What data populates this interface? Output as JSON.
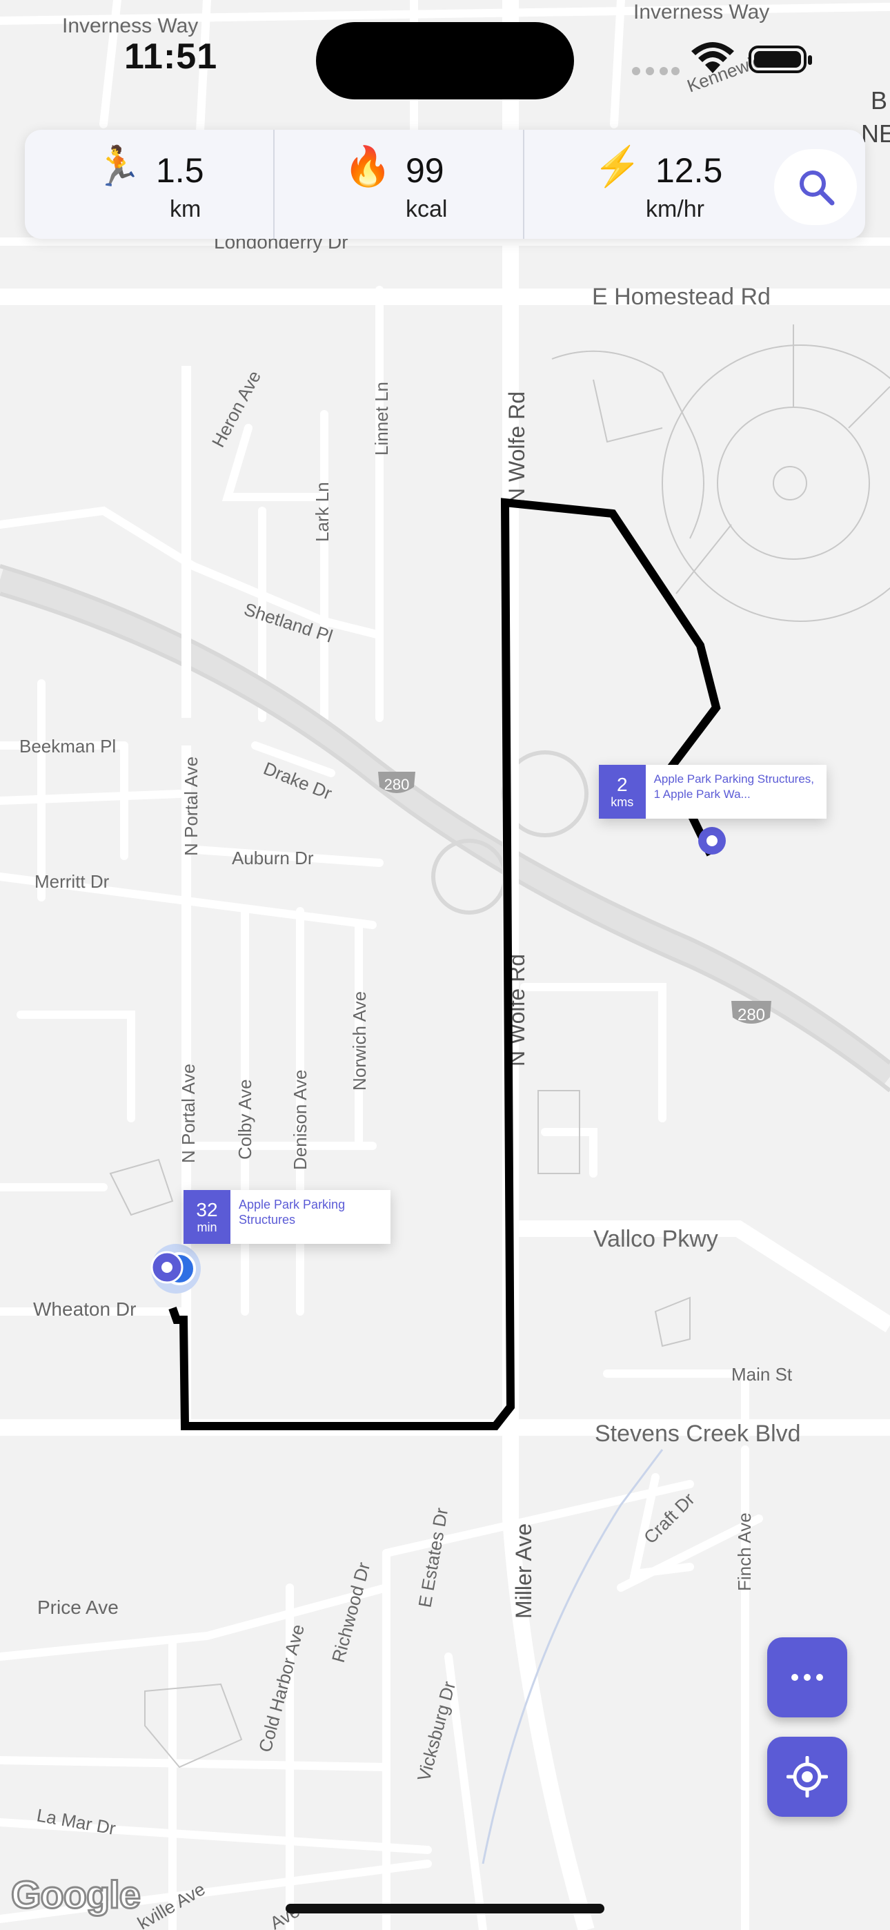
{
  "status_bar": {
    "time": "11:51"
  },
  "stats": [
    {
      "icon": "runner-icon",
      "emoji": "🏃",
      "value": "1.5",
      "unit": "km"
    },
    {
      "icon": "fire-icon",
      "emoji": "🔥",
      "value": "99",
      "unit": "kcal"
    },
    {
      "icon": "lightning-icon",
      "emoji": "⚡",
      "value": "12.5",
      "unit": "km/hr"
    }
  ],
  "map": {
    "streets": {
      "inverness_left": "Inverness Way",
      "inverness_right": "Inverness Way",
      "homestead": "E Homestead Rd",
      "londonderry": "Londonderry Dr",
      "heron": "Heron Ave",
      "linnet": "Linnet Ln",
      "lark": "Lark Ln",
      "shetland": "Shetland Pl",
      "beekman": "Beekman Pl",
      "portal_top": "N Portal Ave",
      "drake": "Drake Dr",
      "auburn": "Auburn Dr",
      "merritt": "Merritt Dr",
      "norwich": "Norwich Ave",
      "wolfe_top": "N Wolfe Rd",
      "wolfe_mid": "N Wolfe Rd",
      "portal_bottom": "N Portal Ave",
      "colby": "Colby Ave",
      "denison": "Denison Ave",
      "vallco": "Vallco Pkwy",
      "wheaton": "Wheaton Dr",
      "main": "Main St",
      "stevens": "Stevens Creek Blvd",
      "estates": "E Estates Dr",
      "miller": "Miller Ave",
      "craft": "Craft Dr",
      "finch": "Finch Ave",
      "price": "Price Ave",
      "cold_harbor": "Cold Harbor Ave",
      "richwood": "Richwood Dr",
      "vicksburg": "Vicksburg Dr",
      "lamar": "La Mar Dr",
      "kville": "kville Ave",
      "ave_bottom": "Ave",
      "kennewick": "Kennewick",
      "b": "B",
      "ne": "NE"
    },
    "highway_shield": "280"
  },
  "markers": {
    "end": {
      "value": "2",
      "unit": "kms",
      "label": "Apple Park Parking Structures, 1 Apple Park Wa..."
    },
    "start": {
      "value": "32",
      "unit": "min",
      "label": "Apple Park Parking Structures"
    }
  },
  "attribution": "Google",
  "colors": {
    "accent": "#5b5bd6",
    "route": "#000000",
    "map_bg": "#f2f2f2"
  }
}
